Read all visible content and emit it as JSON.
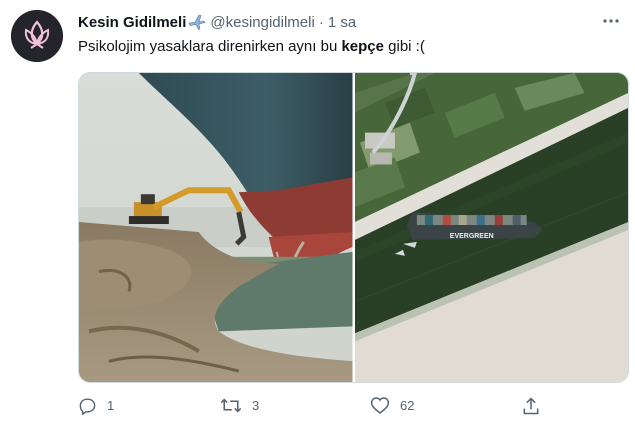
{
  "tweet": {
    "author": {
      "display_name": "Kesin Gidilmeli",
      "name_emoji": "airplane-emoji",
      "handle": "@kesingidilmeli",
      "separator": "·",
      "time": "1 sa",
      "avatar": "pink-lotus-logo-on-dark-circle"
    },
    "text": {
      "before": "Psikolojim yasaklara direnirken aynı bu ",
      "bold": "kepçe",
      "after": " gibi :("
    },
    "media": [
      {
        "name": "excavator-digging-near-ship-bow",
        "description_icon": "photo"
      },
      {
        "name": "satellite-view-ship-stuck-in-canal",
        "ship_hull_text": "EVERGREEN",
        "description_icon": "photo"
      }
    ],
    "actions": {
      "reply": {
        "icon": "reply-icon",
        "count": "1"
      },
      "retweet": {
        "icon": "retweet-icon",
        "count": "3"
      },
      "like": {
        "icon": "heart-icon",
        "count": "62"
      },
      "share": {
        "icon": "share-icon",
        "count": ""
      }
    },
    "colors": {
      "text": "#0f1419",
      "secondary": "#536471",
      "link_blue": "#1d9bf0"
    }
  }
}
